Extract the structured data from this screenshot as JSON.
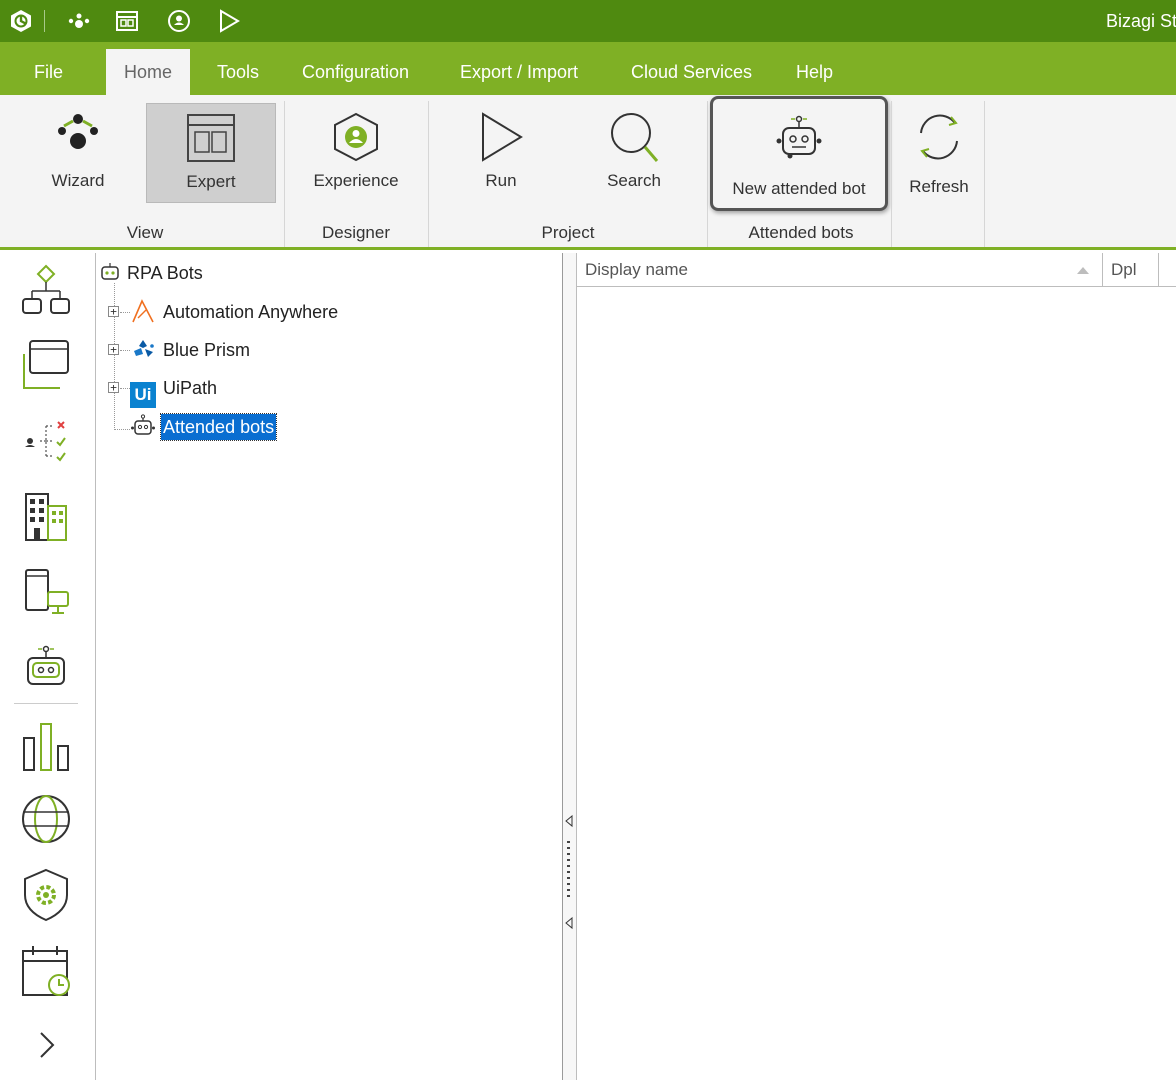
{
  "app": {
    "title": "Bizagi St"
  },
  "menu": {
    "tabs": [
      {
        "label": "File"
      },
      {
        "label": "Home"
      },
      {
        "label": "Tools"
      },
      {
        "label": "Configuration"
      },
      {
        "label": "Export / Import"
      },
      {
        "label": "Cloud Services"
      },
      {
        "label": "Help"
      }
    ]
  },
  "ribbon": {
    "groups": [
      {
        "label": "View"
      },
      {
        "label": "Designer"
      },
      {
        "label": "Project"
      },
      {
        "label": "Attended bots"
      }
    ],
    "buttons": {
      "wizard": "Wizard",
      "expert": "Expert",
      "experience": "Experience",
      "run": "Run",
      "search": "Search",
      "new_attended_bot": "New attended bot",
      "refresh": "Refresh"
    }
  },
  "tree": {
    "root": "RPA Bots",
    "items": [
      {
        "label": "Automation Anywhere"
      },
      {
        "label": "Blue Prism"
      },
      {
        "label": "UiPath"
      },
      {
        "label": "Attended bots"
      }
    ],
    "uipath_badge": "Ui"
  },
  "grid": {
    "columns": [
      {
        "label": "Display name"
      },
      {
        "label": "Dpl"
      }
    ]
  },
  "colors": {
    "titlebar": "#4f8a10",
    "menubar": "#7fb025",
    "selection": "#0a6ed1"
  }
}
